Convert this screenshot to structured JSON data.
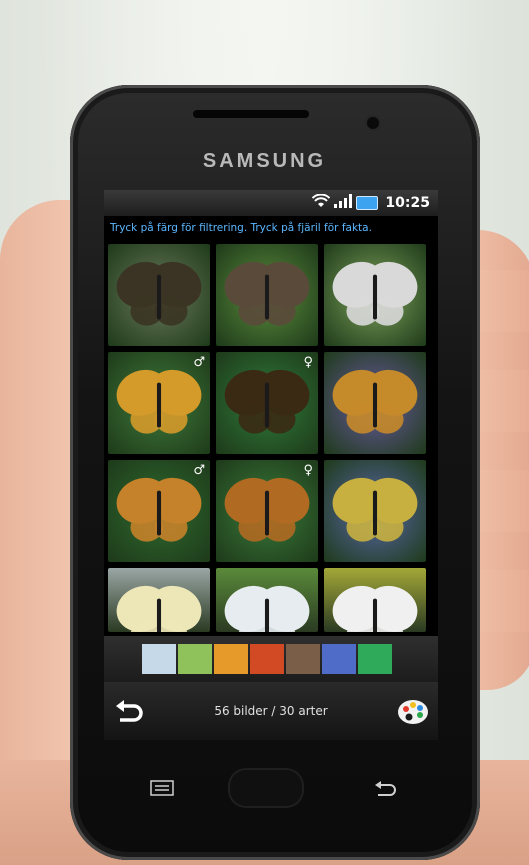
{
  "device": {
    "brand": "SAMSUNG"
  },
  "status_bar": {
    "time": "10:25",
    "icons": [
      "wifi-icon",
      "signal-icon",
      "battery-icon"
    ],
    "battery_color": "#3ba3ef"
  },
  "app": {
    "instruction": "Tryck på färg för filtrering. Tryck på fjäril för fakta.",
    "accent_color": "#5bb7ff",
    "thumbnails": [
      {
        "sex": "",
        "bg": "#6b7a5a",
        "wing": "#3b3424"
      },
      {
        "sex": "",
        "bg": "#5c8c3c",
        "wing": "#5a4a3a"
      },
      {
        "sex": "",
        "bg": "#7da15a",
        "wing": "#d9d9d9"
      },
      {
        "sex": "♂",
        "bg": "#3f7a3a",
        "wing": "#d49a2a"
      },
      {
        "sex": "♀",
        "bg": "#2f7a3a",
        "wing": "#3a2a14"
      },
      {
        "sex": "",
        "bg": "#6a5aa0",
        "wing": "#c58a2a"
      },
      {
        "sex": "♂",
        "bg": "#2f6a2f",
        "wing": "#c5822a"
      },
      {
        "sex": "♀",
        "bg": "#3a7a3a",
        "wing": "#b06a22"
      },
      {
        "sex": "",
        "bg": "#5a68a8",
        "wing": "#c8b040"
      }
    ],
    "partial_thumbnails": [
      {
        "bg": "#9aa6a4",
        "wing": "#ede7b8"
      },
      {
        "bg": "#5a8a3a",
        "wing": "#e6ecef"
      },
      {
        "bg": "#a4a838",
        "wing": "#f0f0f0"
      }
    ],
    "color_filters": [
      {
        "name": "light-blue",
        "hex": "#c5d9e8"
      },
      {
        "name": "light-green",
        "hex": "#8fc25a"
      },
      {
        "name": "orange",
        "hex": "#e69a2a"
      },
      {
        "name": "red",
        "hex": "#d24a24"
      },
      {
        "name": "brown",
        "hex": "#7a5e48"
      },
      {
        "name": "blue",
        "hex": "#4e6cc8"
      },
      {
        "name": "green",
        "hex": "#2faa5a"
      }
    ],
    "footer": {
      "count_text": "56 bilder / 30 arter"
    }
  }
}
